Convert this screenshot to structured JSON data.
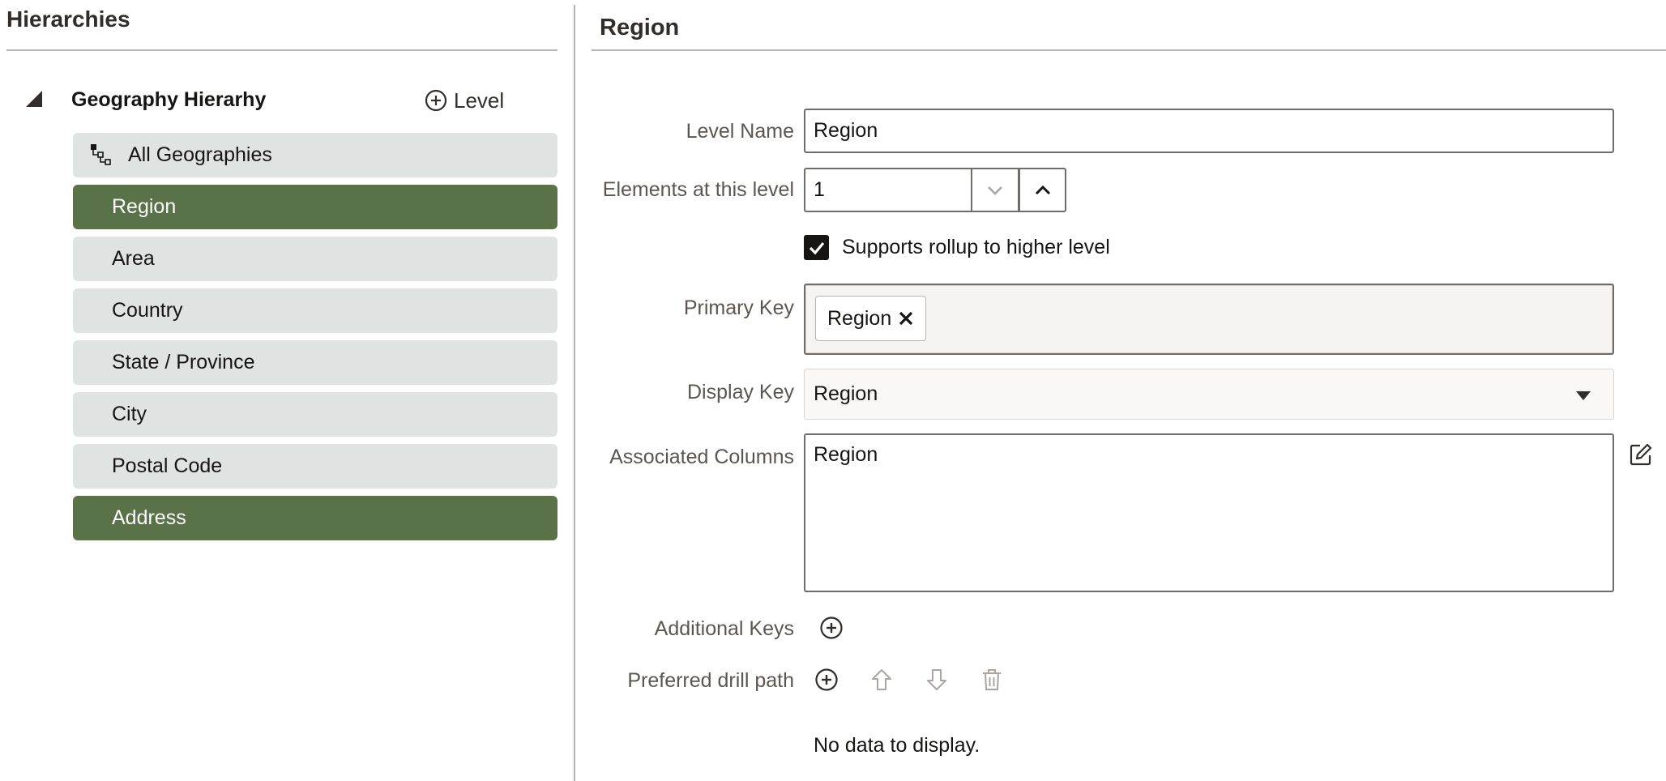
{
  "left_panel": {
    "title": "Hierarchies",
    "hierarchy_name": "Geography Hierarhy",
    "add_level_label": "Level",
    "levels": [
      {
        "label": "All Geographies",
        "selected": false,
        "root": true
      },
      {
        "label": "Region",
        "selected": true
      },
      {
        "label": "Area",
        "selected": false
      },
      {
        "label": "Country",
        "selected": false
      },
      {
        "label": "State / Province",
        "selected": false
      },
      {
        "label": "City",
        "selected": false
      },
      {
        "label": "Postal Code",
        "selected": false
      },
      {
        "label": "Address",
        "selected": true
      }
    ]
  },
  "right_panel": {
    "title": "Region",
    "level_name": {
      "label": "Level Name",
      "value": "Region"
    },
    "elements": {
      "label": "Elements at this level",
      "value": "1"
    },
    "rollup": {
      "label": "Supports rollup to higher level",
      "checked": true
    },
    "primary_key": {
      "label": "Primary Key",
      "chips": [
        "Region"
      ]
    },
    "display_key": {
      "label": "Display Key",
      "value": "Region"
    },
    "associated_columns": {
      "label": "Associated Columns",
      "value": "Region"
    },
    "additional_keys": {
      "label": "Additional Keys"
    },
    "drill_path": {
      "label": "Preferred drill path",
      "empty_text": "No data to display."
    }
  },
  "colors": {
    "selected_bg": "#5a7247",
    "item_bg": "#dfe4e3",
    "text": "#161513"
  }
}
